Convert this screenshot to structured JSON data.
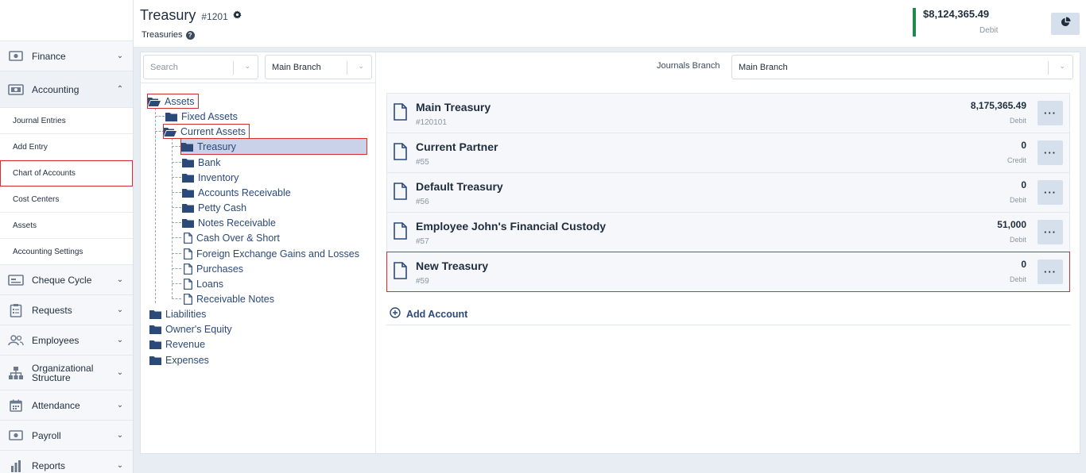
{
  "sidebar": {
    "finance": "Finance",
    "accounting": "Accounting",
    "accounting_subs": [
      "Journal Entries",
      "Add Entry",
      "Chart of Accounts",
      "Cost Centers",
      "Assets",
      "Accounting Settings"
    ],
    "cheque_cycle": "Cheque Cycle",
    "requests": "Requests",
    "employees": "Employees",
    "org_structure": "Organizational Structure",
    "attendance": "Attendance",
    "payroll": "Payroll",
    "reports": "Reports"
  },
  "header": {
    "title": "Treasury",
    "number": "#1201",
    "subtitle": "Treasuries",
    "balance_amount": "$8,124,365.49",
    "balance_type": "Debit",
    "accent_color": "#1e8a4c"
  },
  "filters": {
    "search_placeholder": "Search",
    "branch": "Main Branch",
    "journals_branch_label": "Journals Branch",
    "journals_branch": "Main Branch"
  },
  "tree": {
    "assets": "Assets",
    "fixed_assets": "Fixed Assets",
    "current_assets": "Current Assets",
    "current_children": [
      "Treasury",
      "Bank",
      "Inventory",
      "Accounts Receivable",
      "Petty Cash",
      "Notes Receivable",
      "Cash Over & Short",
      "Foreign Exchange Gains and Losses",
      "Purchases",
      "Loans",
      "Receivable Notes"
    ],
    "liabilities": "Liabilities",
    "owners_equity": "Owner's Equity",
    "revenue": "Revenue",
    "expenses": "Expenses"
  },
  "accounts": [
    {
      "name": "Main Treasury",
      "code": "#120101",
      "amount": "8,175,365.49",
      "type": "Debit"
    },
    {
      "name": "Current Partner",
      "code": "#55",
      "amount": "0",
      "type": "Credit"
    },
    {
      "name": "Default Treasury",
      "code": "#56",
      "amount": "0",
      "type": "Debit"
    },
    {
      "name": "Employee John's Financial Custody",
      "code": "#57",
      "amount": "51,000",
      "type": "Debit"
    },
    {
      "name": "New Treasury",
      "code": "#59",
      "amount": "0",
      "type": "Debit"
    }
  ],
  "more_label": "···",
  "add_account": "Add Account"
}
